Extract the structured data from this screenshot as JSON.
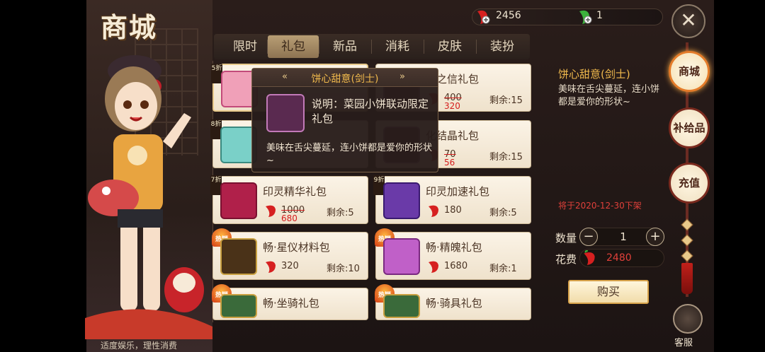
{
  "header": {
    "logo_text": "商城",
    "currency": [
      {
        "icon": "red-chili-icon",
        "value": "2456"
      },
      {
        "icon": "green-chili-icon",
        "value": "1"
      }
    ],
    "close_icon": "close-icon"
  },
  "tabs": [
    {
      "label": "限时"
    },
    {
      "label": "礼包",
      "active": true
    },
    {
      "label": "新品"
    },
    {
      "label": "消耗"
    },
    {
      "label": "皮肤"
    },
    {
      "label": "装扮"
    }
  ],
  "products": [
    {
      "name": "",
      "discount": "5折",
      "price": "",
      "remain": ""
    },
    {
      "name": "者之信礼包",
      "price": "400",
      "new_price": "320",
      "remain": "剩余:15"
    },
    {
      "name": "",
      "discount": "8折",
      "price": "",
      "remain": ""
    },
    {
      "name": "化结晶礼包",
      "price": "70",
      "new_price": "56",
      "remain": "剩余:15"
    },
    {
      "name": "印灵精华礼包",
      "discount": "7折",
      "price": "1000",
      "new_price": "680",
      "remain": "剩余:5"
    },
    {
      "name": "印灵加速礼包",
      "discount": "9折",
      "price": "180",
      "remain": "剩余:5"
    },
    {
      "name": "畅·星仪材料包",
      "badge": "热销",
      "price": "320",
      "remain": "剩余:10"
    },
    {
      "name": "畅·精魄礼包",
      "badge": "热销",
      "price": "1680",
      "remain": "剩余:1"
    },
    {
      "name": "畅·坐骑礼包",
      "badge": "热销"
    },
    {
      "name": "畅·骑具礼包",
      "badge": "热销"
    }
  ],
  "tooltip": {
    "title": "饼心甜意(剑士)",
    "left_arrow": "«",
    "right_arrow": "»",
    "label": "说明：菜园小饼联动限定礼包",
    "description": "美味在舌尖蔓延，连小饼都是爱你的形状~"
  },
  "detail": {
    "title": "饼心甜意(剑士)",
    "description": "美味在舌尖蔓延，连小饼都是爱你的形状~",
    "expire": "将于2020-12-30下架",
    "qty_label": "数量",
    "qty_minus": "−",
    "qty_value": "1",
    "qty_plus": "+",
    "cost_label": "花费",
    "cost_value": "2480",
    "buy_label": "购买"
  },
  "nav": {
    "items": [
      {
        "label": "商城",
        "active": true
      },
      {
        "label": "补给品"
      },
      {
        "label": "充值"
      }
    ],
    "service_label": "客服"
  },
  "footer": {
    "note": "适度娱乐，理性消费"
  },
  "colors": {
    "accent_gold": "#f0b94c",
    "price_red": "#d51d1d",
    "card_bg": "#fbf3e6",
    "nav_border": "#7a2a1e"
  }
}
